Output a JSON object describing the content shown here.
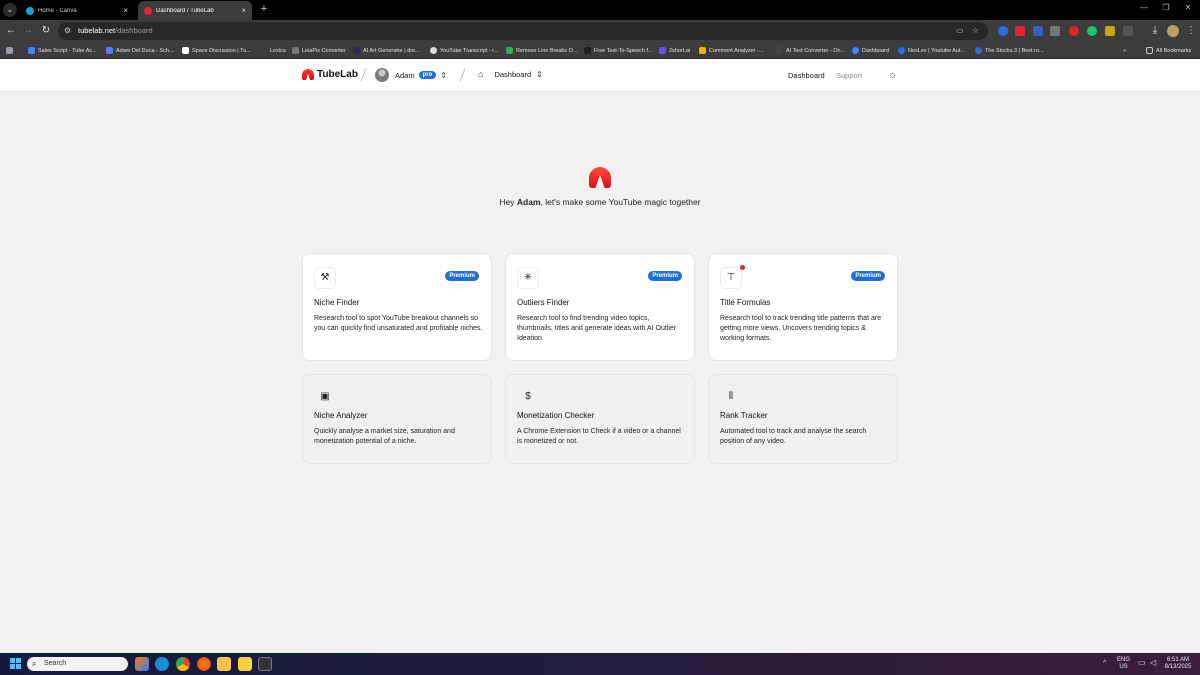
{
  "browser": {
    "tabs": [
      {
        "title": "Home - Canva",
        "close": "×",
        "fav_color": "#1aa5d6",
        "active": false
      },
      {
        "title": "Dashboard / TubeLab",
        "close": "×",
        "fav_color": "#e3262b",
        "active": true
      }
    ],
    "new_tab": "+",
    "url_host": "tubelab.net",
    "url_path": "/dashboard",
    "all_bookmarks": "All Bookmarks",
    "bookmarks": [
      {
        "label": "Sales Script - Tube Ac...",
        "color": "#4285f4"
      },
      {
        "label": "Adam Del Duca - Sch...",
        "color": "#5b7cfa"
      },
      {
        "label": "Space Discussion | Tu...",
        "color": "#ffffff"
      },
      {
        "label": "Lexica",
        "color": "#3c3c3c"
      },
      {
        "label": "LeiaPix Converter",
        "color": "#777777"
      },
      {
        "label": "AI Art Generator | dre...",
        "color": "#2b2b60"
      },
      {
        "label": "YouTube Transcript - r...",
        "color": "#dddddd"
      },
      {
        "label": "Remove Line Breaks O...",
        "color": "#3aa757"
      },
      {
        "label": "Free Text-To-Speech f...",
        "color": "#222222"
      },
      {
        "label": "2short.ai",
        "color": "#6a4cf0"
      },
      {
        "label": "Comment Analyzer -...",
        "color": "#f4b400"
      },
      {
        "label": "AI Text Converter - On...",
        "color": "#444444"
      },
      {
        "label": "Dashboard",
        "color": "#4285f4"
      },
      {
        "label": "NexLev | Youtube Aut...",
        "color": "#1a73e8"
      },
      {
        "label": "The Stocks 3 | Best ro...",
        "color": "#3367d6"
      }
    ]
  },
  "header": {
    "brand": "TubeLab",
    "user_name": "Adam",
    "plan_badge": "pro",
    "breadcrumb": "Dashboard",
    "nav": [
      {
        "label": "Dashboard",
        "active": true
      },
      {
        "label": "Support",
        "active": false
      }
    ],
    "icons": {
      "home": "home-icon",
      "theme": "sun-icon",
      "switcher": "chevron-up-down-icon"
    }
  },
  "hero": {
    "greeting_prefix": "Hey ",
    "greeting_name": "Adam",
    "greeting_suffix": ", let's make some YouTube magic together"
  },
  "tools": [
    {
      "title": "Niche Finder",
      "badge": "Premium",
      "icon": "magic-wand-icon",
      "description": "Research tool to spot YouTube breakout channels so you can quickly find unsaturated and profitable niches."
    },
    {
      "title": "Outliers Finder",
      "badge": "Premium",
      "icon": "sparkle-icon",
      "description": "Research tool to find trending video topics, thumbnails, titles and generate ideas with AI Outlier Ideation."
    },
    {
      "title": "Title Formulas",
      "badge": "Premium",
      "icon": "text-box-icon",
      "description": "Research tool to track trending title patterns that are getting more views. Uncovers trending topics & working formats."
    },
    {
      "title": "Niche Analyzer",
      "badge": "",
      "icon": "analyzer-icon",
      "description": "Quickly analyse a market size, saturation and monetization potential of a niche."
    },
    {
      "title": "Monetization Checker",
      "badge": "",
      "icon": "dollar-icon",
      "description": "A Chrome Extension to Check if a video or a channel is monetized or not."
    },
    {
      "title": "Rank Tracker",
      "badge": "",
      "icon": "soundwave-icon",
      "description": "Automated tool to track and analyse the search position of any video."
    }
  ],
  "taskbar": {
    "search_placeholder": "Search",
    "lang": "ENG",
    "region": "US",
    "time": "6:51 AM",
    "date": "8/13/2025"
  }
}
